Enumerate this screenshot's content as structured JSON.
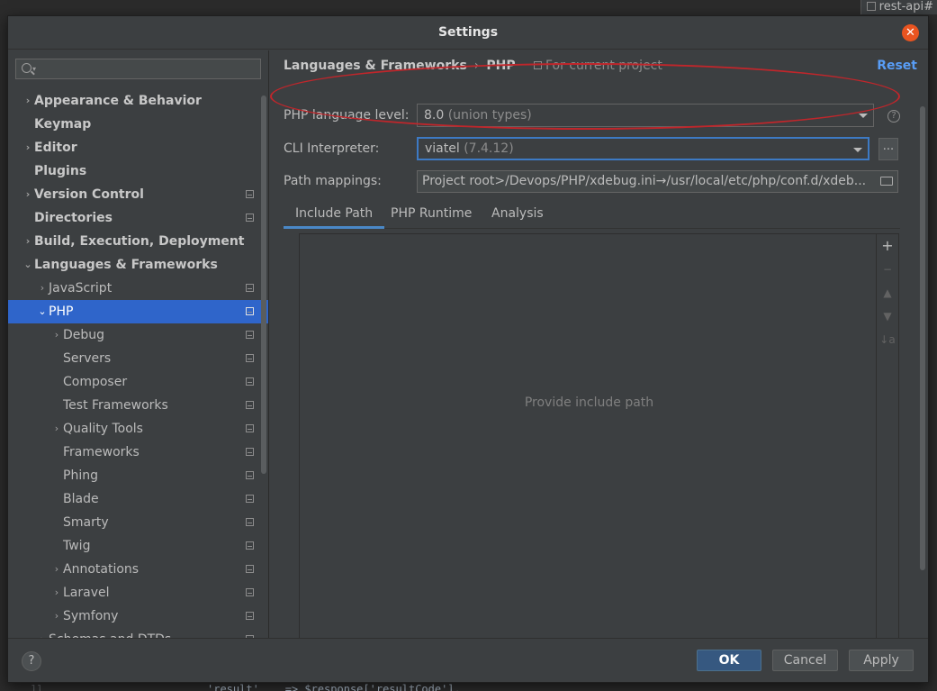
{
  "background": {
    "tab_label": "rest-api#",
    "code_line": "'result'    => $response['resultCode'],",
    "line_number": "11"
  },
  "dialog": {
    "title": "Settings",
    "close_symbol": "✕"
  },
  "search": {
    "placeholder": ""
  },
  "tree": [
    {
      "label": "Appearance & Behavior",
      "bold": true,
      "arrow": "›",
      "level": 0,
      "project": false
    },
    {
      "label": "Keymap",
      "bold": true,
      "arrow": "",
      "level": 0,
      "project": false
    },
    {
      "label": "Editor",
      "bold": true,
      "arrow": "›",
      "level": 0,
      "project": false
    },
    {
      "label": "Plugins",
      "bold": true,
      "arrow": "",
      "level": 0,
      "project": false
    },
    {
      "label": "Version Control",
      "bold": true,
      "arrow": "›",
      "level": 0,
      "project": true
    },
    {
      "label": "Directories",
      "bold": true,
      "arrow": "",
      "level": 0,
      "project": true
    },
    {
      "label": "Build, Execution, Deployment",
      "bold": true,
      "arrow": "›",
      "level": 0,
      "project": false
    },
    {
      "label": "Languages & Frameworks",
      "bold": true,
      "arrow": "⌄",
      "level": 0,
      "project": false
    },
    {
      "label": "JavaScript",
      "bold": false,
      "arrow": "›",
      "level": 1,
      "project": true
    },
    {
      "label": "PHP",
      "bold": false,
      "arrow": "⌄",
      "level": 1,
      "project": true,
      "selected": true
    },
    {
      "label": "Debug",
      "bold": false,
      "arrow": "›",
      "level": 2,
      "project": true
    },
    {
      "label": "Servers",
      "bold": false,
      "arrow": "",
      "level": 2,
      "project": true
    },
    {
      "label": "Composer",
      "bold": false,
      "arrow": "",
      "level": 2,
      "project": true
    },
    {
      "label": "Test Frameworks",
      "bold": false,
      "arrow": "",
      "level": 2,
      "project": true
    },
    {
      "label": "Quality Tools",
      "bold": false,
      "arrow": "›",
      "level": 2,
      "project": true
    },
    {
      "label": "Frameworks",
      "bold": false,
      "arrow": "",
      "level": 2,
      "project": true
    },
    {
      "label": "Phing",
      "bold": false,
      "arrow": "",
      "level": 2,
      "project": true
    },
    {
      "label": "Blade",
      "bold": false,
      "arrow": "",
      "level": 2,
      "project": true
    },
    {
      "label": "Smarty",
      "bold": false,
      "arrow": "",
      "level": 2,
      "project": true
    },
    {
      "label": "Twig",
      "bold": false,
      "arrow": "",
      "level": 2,
      "project": true
    },
    {
      "label": "Annotations",
      "bold": false,
      "arrow": "›",
      "level": 2,
      "project": true
    },
    {
      "label": "Laravel",
      "bold": false,
      "arrow": "›",
      "level": 2,
      "project": true
    },
    {
      "label": "Symfony",
      "bold": false,
      "arrow": "›",
      "level": 2,
      "project": true
    },
    {
      "label": "Schemas and DTDs",
      "bold": false,
      "arrow": "›",
      "level": 1,
      "project": true
    }
  ],
  "content": {
    "breadcrumb": [
      "Languages & Frameworks",
      "PHP"
    ],
    "breadcrumb_sep": "›",
    "scope_label": "For current project",
    "reset_label": "Reset",
    "php_level_label": "PHP language level:",
    "php_level_value": "8.0",
    "php_level_hint": "(union types)",
    "help_symbol": "?",
    "cli_label": "CLI Interpreter:",
    "cli_value": "viatel",
    "cli_version": "(7.4.12)",
    "cli_more_label": "...",
    "path_label": "Path mappings:",
    "path_value": "Project root>/Devops/PHP/xdebug.ini→/usr/local/etc/php/conf.d/xdeb...",
    "tabs": [
      "Include Path",
      "PHP Runtime",
      "Analysis"
    ],
    "empty_text": "Provide include path",
    "toolbar": {
      "add": "+",
      "remove": "−",
      "up": "▲",
      "down": "▼",
      "sort": "↓a"
    }
  },
  "footer": {
    "help_symbol": "?",
    "ok_label": "OK",
    "cancel_label": "Cancel",
    "apply_label": "Apply"
  },
  "colors": {
    "accent": "#2f65ca",
    "link": "#589df6",
    "annotation": "#c0262b",
    "close": "#e95420"
  }
}
